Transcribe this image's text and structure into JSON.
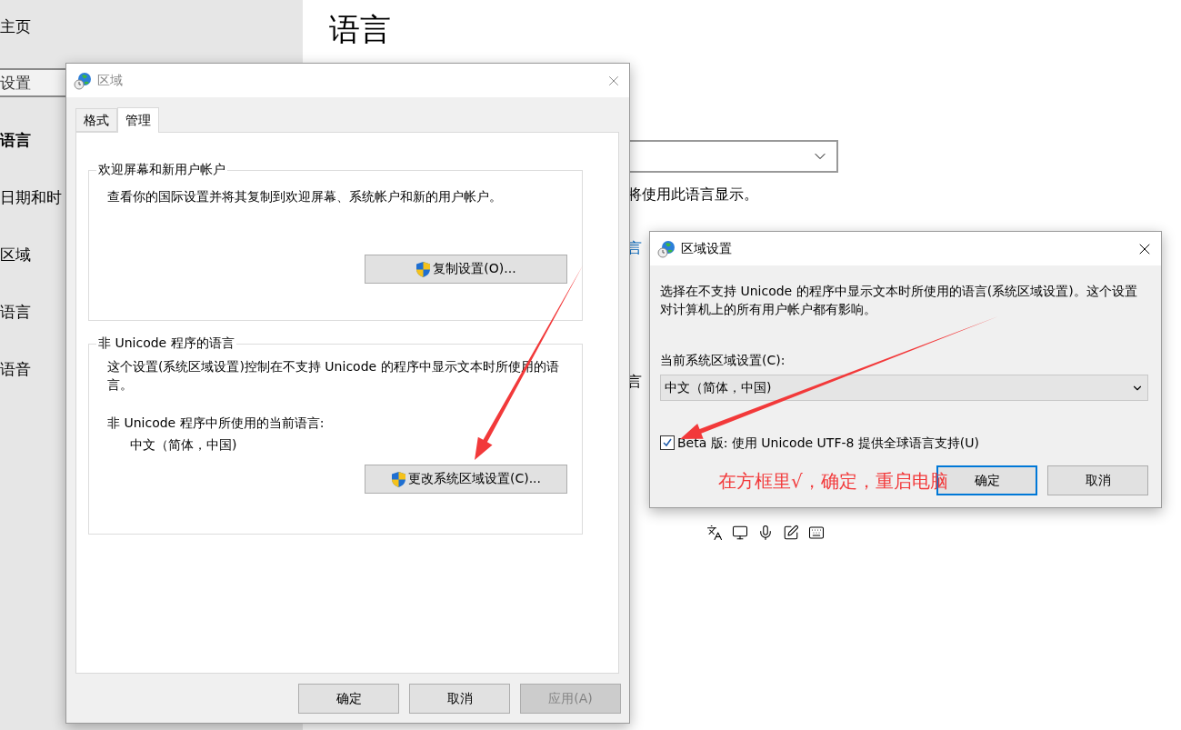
{
  "settings": {
    "sidebar": {
      "home": "主页",
      "search": {
        "value": "设置"
      },
      "heading": "语言",
      "items": [
        {
          "label": "日期和时"
        },
        {
          "label": "区域"
        },
        {
          "label": "语言"
        },
        {
          "label": "语音"
        }
      ]
    },
    "title": "语言",
    "description": "将使用此语言显示。",
    "link": "言",
    "section_label": "言"
  },
  "region_dialog": {
    "title": "区域",
    "tabs": [
      {
        "label": "格式",
        "selected": false
      },
      {
        "label": "管理",
        "selected": true
      }
    ],
    "groups": [
      {
        "title": "欢迎屏幕和新用户帐户",
        "description": "查看你的国际设置并将其复制到欢迎屏幕、系统帐户和新的用户帐户。",
        "button": "复制设置(O)..."
      },
      {
        "title": "非 Unicode 程序的语言",
        "description": "这个设置(系统区域设置)控制在不支持 Unicode 的程序中显示文本时所使用的语言。",
        "current_label": "非 Unicode 程序中所使用的当前语言:",
        "current_value": "中文（简体，中国)",
        "button": "更改系统区域设置(C)..."
      }
    ],
    "buttons": [
      {
        "label": "确定",
        "disabled": false
      },
      {
        "label": "取消",
        "disabled": false
      },
      {
        "label": "应用(A)",
        "disabled": true
      }
    ]
  },
  "locale_dialog": {
    "title": "区域设置",
    "description": "选择在不支持 Unicode 的程序中显示文本时所使用的语言(系统区域设置)。这个设置对计算机上的所有用户帐户都有影响。",
    "select_label": "当前系统区域设置(C):",
    "select_value": "中文（简体，中国)",
    "checkbox": {
      "label": "Beta 版: 使用 Unicode UTF-8 提供全球语言支持(U)",
      "checked": true
    },
    "buttons": [
      {
        "label": "确定",
        "default": true
      },
      {
        "label": "取消",
        "default": false
      }
    ]
  },
  "annotation": {
    "text": "在方框里√，确定，重启电脑"
  }
}
